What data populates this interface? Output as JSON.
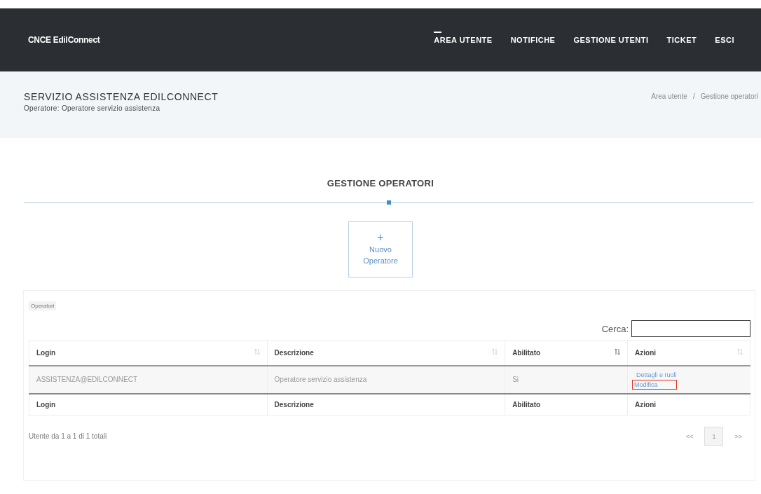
{
  "navbar": {
    "brand": "CNCE EdilConnect",
    "items": [
      {
        "label": "AREA UTENTE",
        "selected": true
      },
      {
        "label": "NOTIFICHE",
        "selected": false
      },
      {
        "label": "GESTIONE UTENTI",
        "selected": false
      },
      {
        "label": "TICKET",
        "selected": false
      },
      {
        "label": "ESCI",
        "selected": false
      }
    ]
  },
  "header": {
    "title": "SERVIZIO ASSISTENZA EDILCONNECT",
    "subtitle": "Operatore: Operatore servizio assistenza",
    "breadcrumb": [
      "Area utente",
      "/",
      "Gestione operatori"
    ]
  },
  "section_title": "GESTIONE OPERATORI",
  "new_button": {
    "icon": "+",
    "label": "Nuovo Operatore"
  },
  "panel": {
    "tag": "Operatori",
    "search": {
      "label": "Cerca:"
    },
    "table": {
      "columns": [
        {
          "label": "Login",
          "sorted": false
        },
        {
          "label": "Descrizione",
          "sorted": false
        },
        {
          "label": "Abilitato",
          "sorted": true
        },
        {
          "label": "Azioni",
          "sorted": false
        }
      ],
      "rows": [
        {
          "login": "ASSISTENZA@EDILCONNECT",
          "description": "Operatore servizio assistenza",
          "enabled": "Si",
          "actions": [
            {
              "label": "Dettagli e ruoli",
              "highlighted": false
            },
            {
              "label": "Modifica",
              "highlighted": true
            }
          ]
        }
      ],
      "footer": [
        "Login",
        "Descrizione",
        "Abilitato",
        "Azioni"
      ]
    },
    "summary": "Utente da 1 a 1 di 1 totali",
    "pagination": [
      {
        "label": "<<",
        "selected": false
      },
      {
        "label": "1",
        "selected": true
      },
      {
        "label": ">>",
        "selected": false
      }
    ]
  }
}
